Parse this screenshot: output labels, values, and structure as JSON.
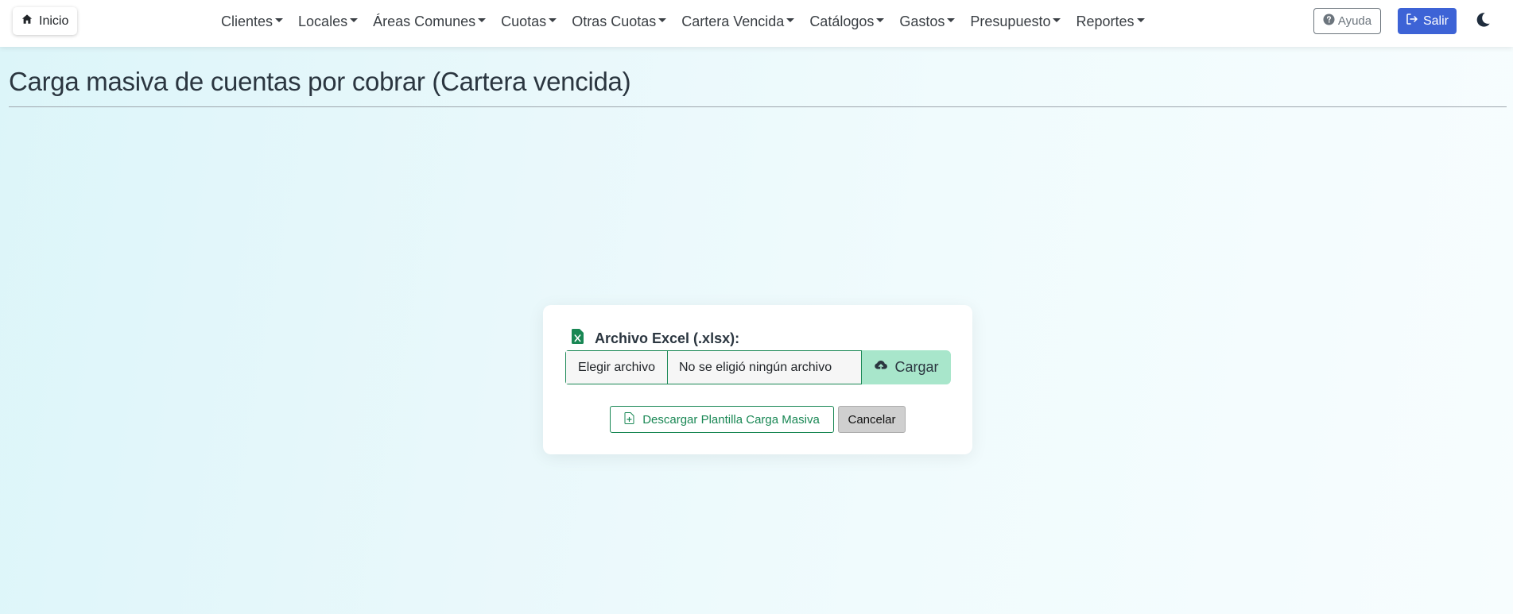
{
  "navbar": {
    "home_label": "Inicio",
    "menu_items": [
      {
        "label": "Clientes"
      },
      {
        "label": "Locales"
      },
      {
        "label": "Áreas Comunes"
      },
      {
        "label": "Cuotas"
      },
      {
        "label": "Otras Cuotas"
      },
      {
        "label": "Cartera Vencida"
      },
      {
        "label": "Catálogos"
      },
      {
        "label": "Gastos"
      },
      {
        "label": "Presupuesto"
      },
      {
        "label": "Reportes"
      }
    ],
    "help_label": "Ayuda",
    "exit_label": "Salir",
    "icons": {
      "home": "home-icon",
      "help": "question-circle-icon",
      "exit": "sign-out-icon",
      "theme": "moon-icon"
    }
  },
  "header": {
    "title": "Carga masiva de cuentas por cobrar (Cartera vencida)"
  },
  "upload_form": {
    "file_label": "Archivo Excel (.xlsx):",
    "choose_file_label": "Elegir archivo",
    "file_status": "No se eligió ningún archivo",
    "upload_label": "Cargar",
    "download_template_label": "Descargar Plantilla Carga Masiva",
    "cancel_label": "Cancelar",
    "icons": {
      "file": "excel-file-icon",
      "upload": "cloud-upload-icon",
      "download": "file-plus-icon"
    }
  },
  "colors": {
    "primary": "#3d63d6",
    "success": "#198754",
    "upload_button_bg": "#a8e6cb",
    "secondary": "#6c757d"
  }
}
